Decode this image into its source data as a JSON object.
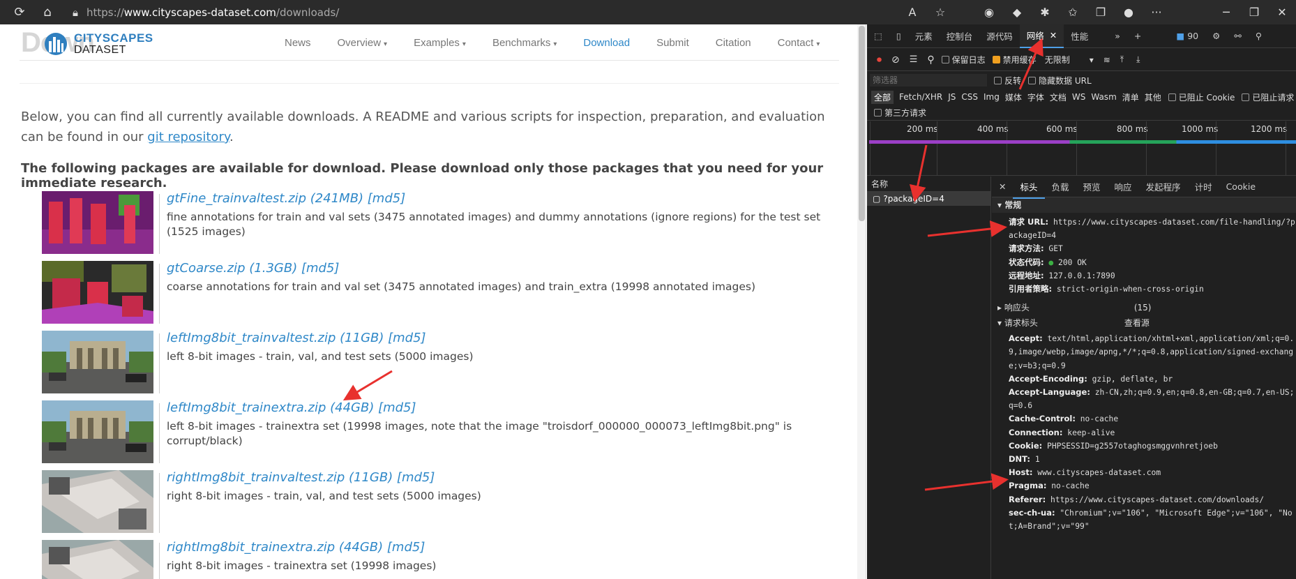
{
  "browser": {
    "url_prefix": "https://",
    "url_domain": "www.cityscapes-dataset.com",
    "url_path": "/downloads/",
    "extension_badge": "90"
  },
  "site": {
    "logo_watermark": "Down",
    "logo_line1": "CITYSCAPES",
    "logo_line2": "DATASET",
    "nav": [
      {
        "label": "News"
      },
      {
        "label": "Overview",
        "caret": "▾"
      },
      {
        "label": "Examples",
        "caret": "▾"
      },
      {
        "label": "Benchmarks",
        "caret": "▾"
      },
      {
        "label": "Download"
      },
      {
        "label": "Submit"
      },
      {
        "label": "Citation"
      },
      {
        "label": "Contact",
        "caret": "▾"
      }
    ],
    "intro_a": "Below, you can find all currently available downloads. A README and various scripts for inspection, preparation, and evaluation can be found in our ",
    "intro_link": "git repository",
    "intro_b": ".",
    "packages_heading": "The following packages are available for download. Please download only those packages that you need for your immediate research.",
    "packages": [
      {
        "title": "gtFine_trainvaltest.zip (241MB) [md5]",
        "desc": "fine annotations for train and val sets (3475 annotated images) and dummy annotations (ignore regions) for the test set (1525 images)"
      },
      {
        "title": "gtCoarse.zip (1.3GB) [md5]",
        "desc": "coarse annotations for train and val set (3475 annotated images) and train_extra (19998 annotated images)"
      },
      {
        "title": "leftImg8bit_trainvaltest.zip (11GB) [md5]",
        "desc": "left 8-bit images - train, val, and test sets (5000 images)"
      },
      {
        "title": "leftImg8bit_trainextra.zip (44GB) [md5]",
        "desc": "left 8-bit images - trainextra set (19998 images, note that the image \"troisdorf_000000_000073_leftImg8bit.png\" is corrupt/black)"
      },
      {
        "title": "rightImg8bit_trainvaltest.zip (11GB) [md5]",
        "desc": "right 8-bit images - train, val, and test sets (5000 images)"
      },
      {
        "title": "rightImg8bit_trainextra.zip (44GB) [md5]",
        "desc": "right 8-bit images - trainextra set (19998 images)"
      }
    ]
  },
  "devtools": {
    "tabs": [
      "元素",
      "控制台",
      "源代码",
      "网络",
      "性能"
    ],
    "toolbar": {
      "preserve_log": "保留日志",
      "disable_cache": "禁用缓存",
      "throttle": "无限制"
    },
    "filter_placeholder": "筛选器",
    "invert": "反转",
    "hide_data_urls": "隐藏数据 URL",
    "types": [
      "全部",
      "Fetch/XHR",
      "JS",
      "CSS",
      "Img",
      "媒体",
      "字体",
      "文档",
      "WS",
      "Wasm",
      "清单",
      "其他"
    ],
    "blocked_cookies": "已阻止 Cookie",
    "blocked_requests": "已阻止请求",
    "third_party": "第三方请求",
    "ticks": [
      "200 ms",
      "400 ms",
      "600 ms",
      "800 ms",
      "1000 ms",
      "1200 ms"
    ],
    "name_header": "名称",
    "request_name": "?packageID=4",
    "detail_tabs": [
      "标头",
      "负载",
      "预览",
      "响应",
      "发起程序",
      "计时",
      "Cookie"
    ],
    "general_title": "常规",
    "general": [
      {
        "k": "请求 URL:",
        "v": "https://www.cityscapes-dataset.com/file-handling/?packageID=4"
      },
      {
        "k": "请求方法:",
        "v": "GET"
      },
      {
        "k": "状态代码:",
        "v": "200 OK"
      },
      {
        "k": "远程地址:",
        "v": "127.0.0.1:7890"
      },
      {
        "k": "引用者策略:",
        "v": "strict-origin-when-cross-origin"
      }
    ],
    "response_headers": "响应头",
    "response_count": "(15)",
    "request_headers": "请求标头",
    "view_source": "查看源",
    "headers": [
      {
        "k": "Accept:",
        "v": "text/html,application/xhtml+xml,application/xml;q=0.9,image/webp,image/apng,*/*;q=0.8,application/signed-exchange;v=b3;q=0.9"
      },
      {
        "k": "Accept-Encoding:",
        "v": "gzip, deflate, br"
      },
      {
        "k": "Accept-Language:",
        "v": "zh-CN,zh;q=0.9,en;q=0.8,en-GB;q=0.7,en-US;q=0.6"
      },
      {
        "k": "Cache-Control:",
        "v": "no-cache"
      },
      {
        "k": "Connection:",
        "v": "keep-alive"
      },
      {
        "k": "Cookie:",
        "v": "PHPSESSID=g2557otaghogsmggvnhretjoeb"
      },
      {
        "k": "DNT:",
        "v": "1"
      },
      {
        "k": "Host:",
        "v": "www.cityscapes-dataset.com"
      },
      {
        "k": "Pragma:",
        "v": "no-cache"
      },
      {
        "k": "Referer:",
        "v": "https://www.cityscapes-dataset.com/downloads/"
      },
      {
        "k": "sec-ch-ua:",
        "v": "\"Chromium\";v=\"106\", \"Microsoft Edge\";v=\"106\", \"Not;A=Brand\";v=\"99\""
      }
    ]
  },
  "colors": {
    "link": "#2f88c8",
    "accent": "#4fa0e8",
    "annotation_arrow": "#e8312e"
  }
}
